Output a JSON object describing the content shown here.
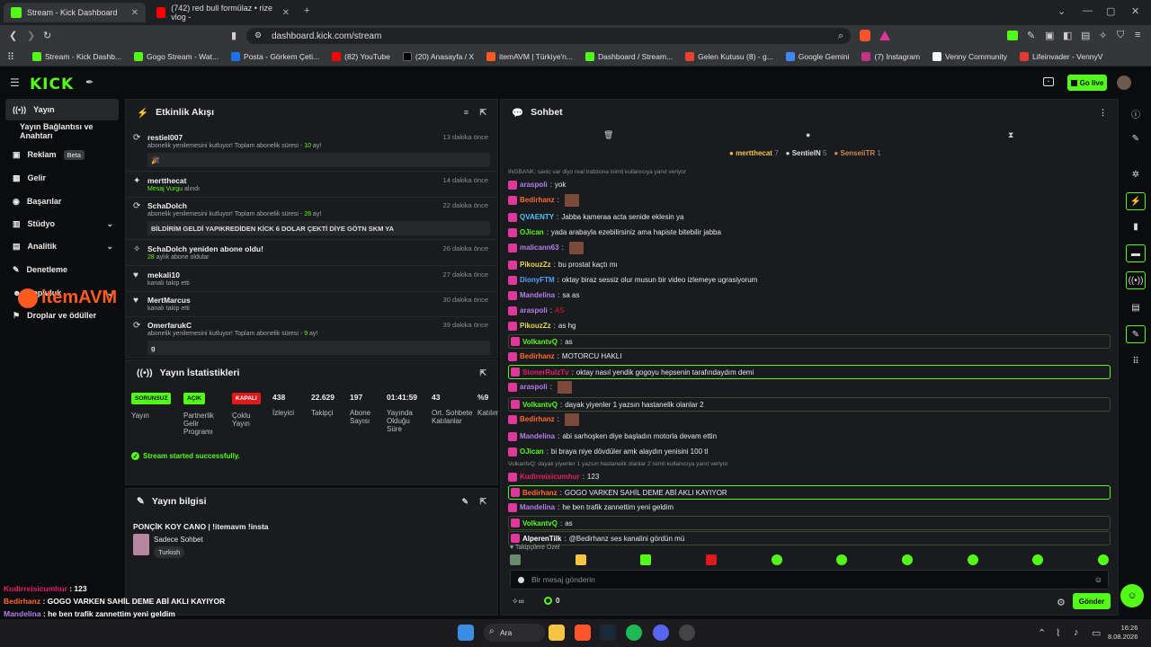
{
  "browser": {
    "tabs": [
      {
        "title": "Stream - Kick Dashboard",
        "color": "#53fc18"
      },
      {
        "title": "(742) red bull formülaz • rize vlog -",
        "color": "#ff0000"
      }
    ],
    "url": "dashboard.kick.com/stream",
    "bookmarks": [
      {
        "label": "Stream - Kick Dashb...",
        "color": "#53fc18"
      },
      {
        "label": "Gogo Stream - Wat...",
        "color": "#53fc18"
      },
      {
        "label": "Posta - Görkem Çeti...",
        "color": "#1a73e8"
      },
      {
        "label": "(82) YouTube",
        "color": "#ff0000"
      },
      {
        "label": "(20) Anasayfa / X",
        "color": "#000000"
      },
      {
        "label": "itemAVM | Türkiye'n...",
        "color": "#ff5a1f"
      },
      {
        "label": "Dashboard / Stream...",
        "color": "#53fc18"
      },
      {
        "label": "Gelen Kutusu (8) - g...",
        "color": "#ea4335"
      },
      {
        "label": "Google Gemini",
        "color": "#4285f4"
      },
      {
        "label": "(7) Instagram",
        "color": "#c13584"
      },
      {
        "label": "Venny Community",
        "color": "#ffffff"
      },
      {
        "label": "Lifeinvader - VennyV",
        "color": "#e53935"
      }
    ]
  },
  "header": {
    "logo": "KICK",
    "golive": "Go live"
  },
  "sidebar": {
    "items": [
      {
        "label": "Yayın",
        "icon": "broadcast-icon"
      },
      {
        "label": "Yayın Bağlantısı ve Anahtarı",
        "icon": ""
      },
      {
        "label": "Reklam",
        "icon": "ad-icon",
        "badge": "Beta"
      },
      {
        "label": "Gelir",
        "icon": "coin-icon"
      },
      {
        "label": "Başarılar",
        "icon": "trophy-icon"
      },
      {
        "label": "Stüdyo",
        "icon": "studio-icon"
      },
      {
        "label": "Analitik",
        "icon": "chart-icon"
      },
      {
        "label": "Denetleme",
        "icon": "hammer-icon"
      },
      {
        "label": "Topluluk",
        "icon": "community-icon"
      },
      {
        "label": "Droplar ve ödüller",
        "icon": "gift-icon"
      }
    ],
    "watermark": "itemAVM"
  },
  "activity": {
    "title": "Etkinlik Akışı",
    "events": [
      {
        "user": "restiel007",
        "time": "13 dakika önce",
        "desc_pre": "abonelik yenilemesini kutluyor! Toplam abonelik süresi - ",
        "num": "10",
        "desc_post": " ay!",
        "msg": "🎉"
      },
      {
        "user": "mertthecat",
        "time": "14 dakika önce",
        "desc_pre": "Mesaj Vurgu",
        "num": "",
        "desc_post": " alındı",
        "msg": ""
      },
      {
        "user": "SchaDolch",
        "time": "22 dakika önce",
        "desc_pre": "abonelik yenilemesini kutluyor! Toplam abonelik süresi - ",
        "num": "28",
        "desc_post": " ay!",
        "msg": "BİLDİRİM GELDİ YAPIKREDİDEN KİCK 6 DOLAR ÇEKTİ DİYE GÖTN SKM YA"
      },
      {
        "user": "SchaDolch yeniden abone oldu!",
        "time": "26 dakika önce",
        "desc_pre": "",
        "num": "28",
        "desc_post": " aylık abone oldular",
        "msg": ""
      },
      {
        "user": "mekali10",
        "time": "27 dakika önce",
        "desc_pre": "kanalı takip etti",
        "num": "",
        "desc_post": "",
        "msg": ""
      },
      {
        "user": "MertMarcus",
        "time": "30 dakika önce",
        "desc_pre": "kanalı takip etti",
        "num": "",
        "desc_post": "",
        "msg": ""
      },
      {
        "user": "OmerfarukC",
        "time": "39 dakika önce",
        "desc_pre": "abonelik yenilemesini kutluyor! Toplam abonelik süresi - ",
        "num": "9",
        "desc_post": " ay!",
        "msg": "g"
      }
    ]
  },
  "stats": {
    "title": "Yayın İstatistikleri",
    "cols": [
      {
        "value": "SORUNSUZ",
        "label": "Yayın",
        "kind": "badge",
        "color": "#53fc18"
      },
      {
        "value": "AÇIK",
        "label": "Partnerlik Gelir Programı",
        "kind": "badge",
        "color": "#53fc18"
      },
      {
        "value": "KAPALI",
        "label": "Çoklu Yayın",
        "kind": "badge",
        "color": "#e0191d"
      },
      {
        "value": "438",
        "label": "İzleyici",
        "kind": "num"
      },
      {
        "value": "22.629",
        "label": "Takipçi",
        "kind": "num"
      },
      {
        "value": "197",
        "label": "Abone Sayısı",
        "kind": "num"
      },
      {
        "value": "01:41:59",
        "label": "Yayında Olduğu Süre",
        "kind": "num"
      },
      {
        "value": "43",
        "label": "Ort. Sohbete Katılanlar",
        "kind": "num"
      },
      {
        "value": "%9",
        "label": "Katılım",
        "kind": "num"
      }
    ],
    "success": "Stream started successfully."
  },
  "info": {
    "title": "Yayın bilgisi",
    "stream_title": "PONÇİK KOY CANO | !itemavm !insta",
    "category": "Sadece Sohbet",
    "tag": "Turkish"
  },
  "chat": {
    "title": "Sohbet",
    "top": [
      {
        "name": "mertthecat",
        "count": "7"
      },
      {
        "name": "SentieIN",
        "count": "5"
      },
      {
        "name": "SenseiiTR",
        "count": "1"
      }
    ],
    "lines": [
      {
        "reply": "INGBANK: savic var diyo real trabzona isimli kullanıcıya yanıt veriyor"
      },
      {
        "name": "araspoli",
        "color": "#b37feb",
        "text": "yok"
      },
      {
        "name": "Bedirhanz",
        "color": "#ff6a2a",
        "text": "",
        "emote": true
      },
      {
        "name": "QVAENTY",
        "color": "#4fc3f7",
        "text": "Jabba kameraa acta senide eklesin ya"
      },
      {
        "name": "OJican",
        "color": "#53fc18",
        "text": "yada arabayla ezebilirsiniz ama hapiste bitebilir jabba"
      },
      {
        "name": "malicann63",
        "color": "#b37feb",
        "text": "",
        "emote": true
      },
      {
        "name": "PikouzZz",
        "color": "#e6d94c",
        "text": "bu prostat kaçtı mı"
      },
      {
        "name": "DionyFTM",
        "color": "#4fa3f7",
        "text": "oktay biraz sessiz olur musun bir video izlemeye ugrasiyorum"
      },
      {
        "name": "Mandelina",
        "color": "#b37feb",
        "text": "sa as"
      },
      {
        "name": "araspoli",
        "color": "#b37feb",
        "text": "AS"
      },
      {
        "name": "PikouzZz",
        "color": "#e6d94c",
        "text": "as hg"
      },
      {
        "name": "VolkantvQ",
        "color": "#53fc18",
        "text": "as",
        "hl": "y"
      },
      {
        "name": "Bedirhanz",
        "color": "#ff6a2a",
        "text": "MOTORCU HAKLI"
      },
      {
        "name": "StonerRulzTv",
        "color": "#e91e63",
        "text": "oktay nasıl yendik gogoyu hepsenin tarafındaydım demi",
        "hl": "g"
      },
      {
        "name": "araspoli",
        "color": "#b37feb",
        "text": "",
        "emote": true
      },
      {
        "name": "VolkantvQ",
        "color": "#53fc18",
        "text": "dayak yiyenler 1 yazsın hastanelik olanlar 2",
        "hl": "y"
      },
      {
        "name": "Bedirhanz",
        "color": "#ff6a2a",
        "text": "",
        "emote": true
      },
      {
        "name": "Mandelina",
        "color": "#b37feb",
        "text": "abi sarhoşken diye başladın motorla devam ettin"
      },
      {
        "name": "OJican",
        "color": "#53fc18",
        "text": "bi braya niye dövdüler amk alaydın yenisini 100 tl"
      },
      {
        "reply": "VolkantvQ: dayak yiyenler 1 yazsın hastanelik olanlar 2 isimli kullanıcıya yanıt veriyor"
      },
      {
        "name": "Kudirreisicumhur",
        "color": "#e91e63",
        "text": "123"
      },
      {
        "name": "Bedirhanz",
        "color": "#ff6a2a",
        "text": "GOGO VARKEN SAHİL DEME ABİ AKLI KAYIYOR",
        "hl": "g"
      },
      {
        "name": "Mandelina",
        "color": "#b37feb",
        "text": "he ben trafik zannettim yeni geldim"
      },
      {
        "name": "VolkantvQ",
        "color": "#53fc18",
        "text": "as",
        "hl": "y"
      },
      {
        "name": "AlperenTilk",
        "color": "#ffffff",
        "text": "@Bedirhanz ses kanalini gördün mü",
        "mention": true,
        "hl": "y"
      }
    ],
    "followers_only": "Takipçilere Özel",
    "placeholder": "Bir mesaj gönderin",
    "send": "Gönder",
    "points": "0"
  },
  "overlay": [
    {
      "name": "Kudirreisicumhur",
      "color": "#e91e63",
      "text": "123"
    },
    {
      "name": "Bedirhanz",
      "color": "#ff6a2a",
      "text": "GOGO VARKEN SAHİL DEME ABİ AKLI KAYIYOR"
    },
    {
      "name": "Mandelina",
      "color": "#b37feb",
      "text": "he ben trafik zannettim yeni geldim"
    },
    {
      "name": "VolkantvQ",
      "color": "#53fc18",
      "text": "as"
    },
    {
      "name": "AlperenTilk",
      "color": "#ffffff",
      "text": "@Bedirhanz ses kanalini gördün mü"
    }
  ],
  "taskbar": {
    "search": "Ara",
    "time": "16:26",
    "date": "8.08.2026"
  }
}
